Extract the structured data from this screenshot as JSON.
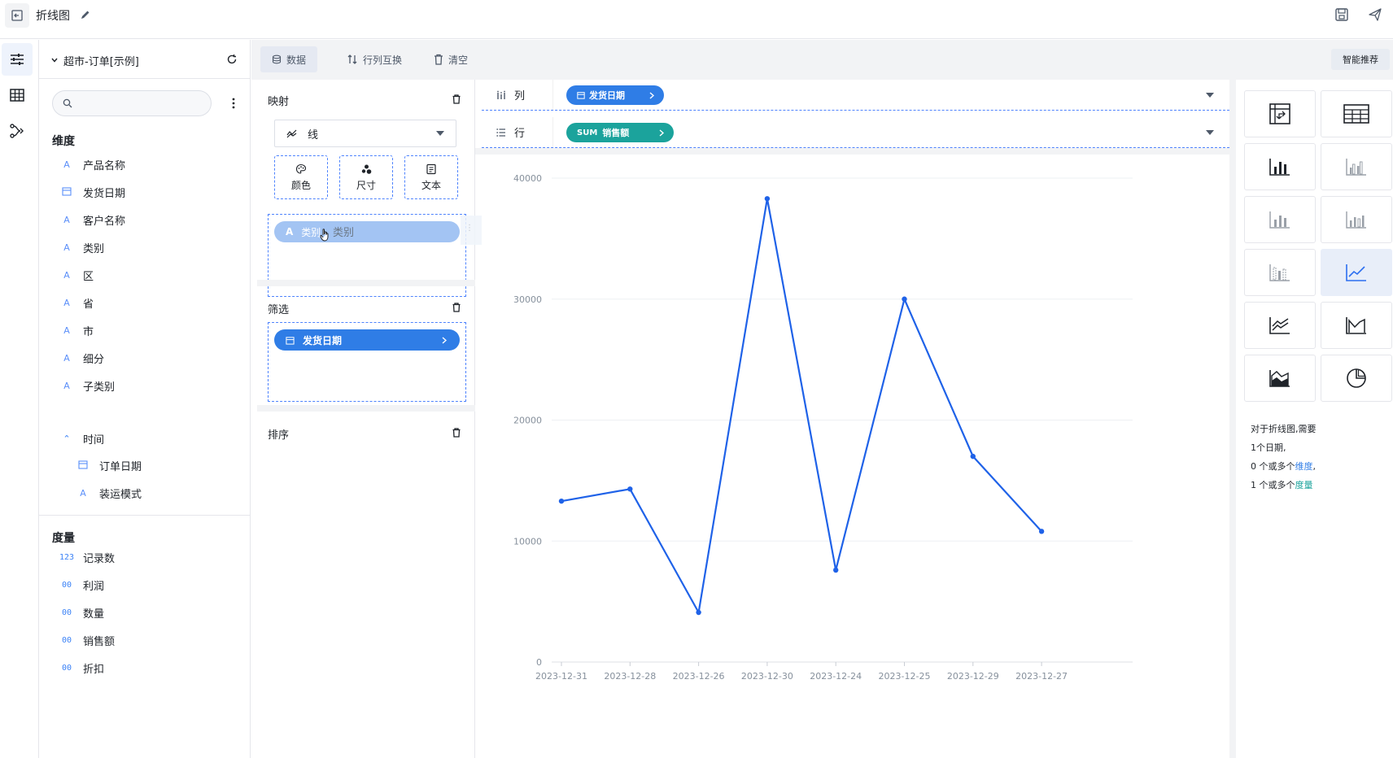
{
  "app": {
    "title": "折线图"
  },
  "fields_panel": {
    "dataset_name": "超市-订单[示例]",
    "dimensions_title": "维度",
    "dimensions": [
      "产品名称",
      "发货日期",
      "客户名称",
      "类别",
      "区",
      "省",
      "市",
      "细分",
      "子类别"
    ],
    "time_group": {
      "label": "时间",
      "children": [
        "订单日期",
        "装运模式"
      ]
    },
    "measures_title": "度量",
    "measures": [
      "记录数",
      "利润",
      "数量",
      "销售额",
      "折扣"
    ],
    "measure_icons": [
      "123",
      "00",
      "00",
      "00",
      "00"
    ],
    "dim_icons": [
      "A",
      "cal",
      "A",
      "A",
      "A",
      "A",
      "A",
      "A",
      "A"
    ]
  },
  "toolbar": {
    "data_label": "数据",
    "swap_label": "行列互换",
    "clear_label": "清空",
    "smart_label": "智能推荐"
  },
  "mapping": {
    "title": "映射",
    "chart_type": "线",
    "color_label": "颜色",
    "size_label": "尺寸",
    "text_label": "文本",
    "dragging_pill": "类别",
    "dragging_ghost": "类别",
    "filter_title": "筛选",
    "filter_pill": "发货日期",
    "sort_title": "排序"
  },
  "shelves": {
    "columns_label": "列",
    "columns_pill": "发货日期",
    "rows_label": "行",
    "rows_pill_agg": "SUM",
    "rows_pill_field": "销售额"
  },
  "right_panel": {
    "hint_line1": "对于折线图,需要",
    "hint_line2": "1个日期,",
    "hint_line3_prefix": "0 个或多个",
    "hint_line3_link": "维度",
    "hint_line3_suffix": ",",
    "hint_line4_prefix": "1 个或多个",
    "hint_line4_link": "度量"
  },
  "colors": {
    "accent": "#2c6ff0",
    "line": "#1f62e8",
    "pill_blue": "#2f7de6",
    "pill_green": "#1ba39c",
    "dim_link": "#2f7de6",
    "measure_link": "#1ba39c"
  },
  "chart_data": {
    "type": "line",
    "categories": [
      "2023-12-31",
      "2023-12-28",
      "2023-12-26",
      "2023-12-30",
      "2023-12-24",
      "2023-12-25",
      "2023-12-29",
      "2023-12-27"
    ],
    "values": [
      13300,
      14300,
      4100,
      38300,
      7600,
      30000,
      17000,
      10800
    ],
    "ylim": [
      0,
      40000
    ],
    "yticks": [
      0,
      10000,
      20000,
      30000,
      40000
    ],
    "grid": true,
    "xlabel": "",
    "ylabel": ""
  }
}
